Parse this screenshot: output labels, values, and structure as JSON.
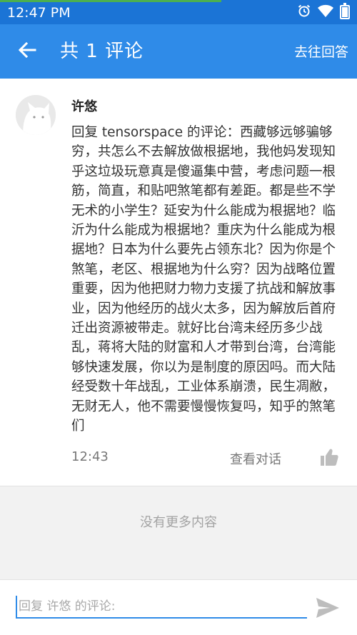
{
  "status_bar": {
    "time": "12:47 PM",
    "icons": [
      "alarm-icon",
      "wifi-icon",
      "battery-icon"
    ],
    "background": "#1b74d6",
    "progress_color": "#4caf50",
    "progress_fraction": 0.62
  },
  "app_bar": {
    "title": "共 1 评论",
    "action_label": "去往回答",
    "background": "#2f8be8"
  },
  "comment": {
    "author": "许悠",
    "text": "回复 tensorspace 的评论：西藏够远够骗够穷，共怎么不去解放做根据地，我他妈发现知乎这垃圾玩意真是傻逼集中营，考虑问题一根筋，简直，和贴吧煞笔都有差距。都是些不学无术的小学生？延安为什么能成为根据地？临沂为什么能成为根据地？重庆为什么能成为根据地？日本为什么要先占领东北？因为你是个煞笔，老区、根据地为什么穷？因为战略位置重要，因为他把财力物力支援了抗战和解放事业，因为他经历的战火太多，因为解放后首府迁出资源被带走。就好比台湾未经历多少战乱，蒋将大陆的财富和人才带到台湾，台湾能够快速发展，你以为是制度的原因吗。而大陆经受数十年战乱，工业体系崩溃，民生凋敝，无财无人，他不需要慢慢恢复吗，知乎的煞笔们",
    "time": "12:43",
    "view_conversation_label": "查看对话"
  },
  "footer": {
    "no_more_label": "没有更多内容"
  },
  "reply": {
    "placeholder": "回复 许悠 的评论:"
  },
  "colors": {
    "accent": "#2f8be8",
    "muted_text": "#777777",
    "gray_background": "#f2f2f2"
  }
}
